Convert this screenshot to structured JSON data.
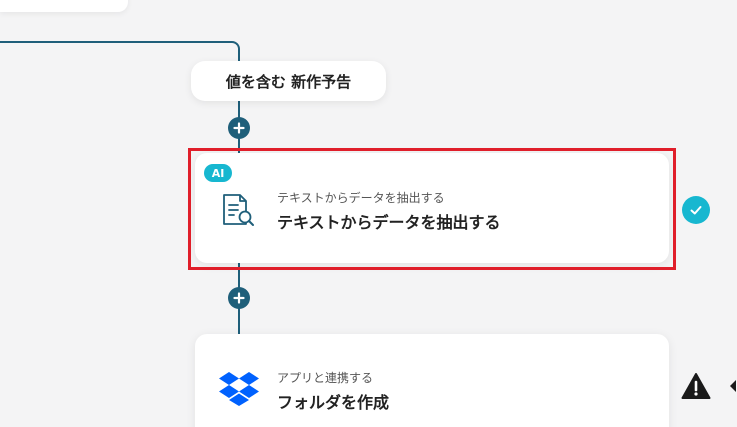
{
  "flow": {
    "condition_label": "値を含む 新作予告",
    "steps": [
      {
        "badge": "AI",
        "subtitle": "テキストからデータを抽出する",
        "title": "テキストからデータを抽出する",
        "icon": "document-search-icon",
        "status": "completed",
        "highlighted": true
      },
      {
        "subtitle": "アプリと連携する",
        "title": "フォルダを作成",
        "icon": "dropbox-icon",
        "status": "warning"
      }
    ]
  },
  "colors": {
    "connector": "#1f5f7a",
    "accent": "#17b7d0",
    "highlight": "#e01e2a",
    "dropbox": "#0061fe",
    "background": "#f4f4f5"
  }
}
